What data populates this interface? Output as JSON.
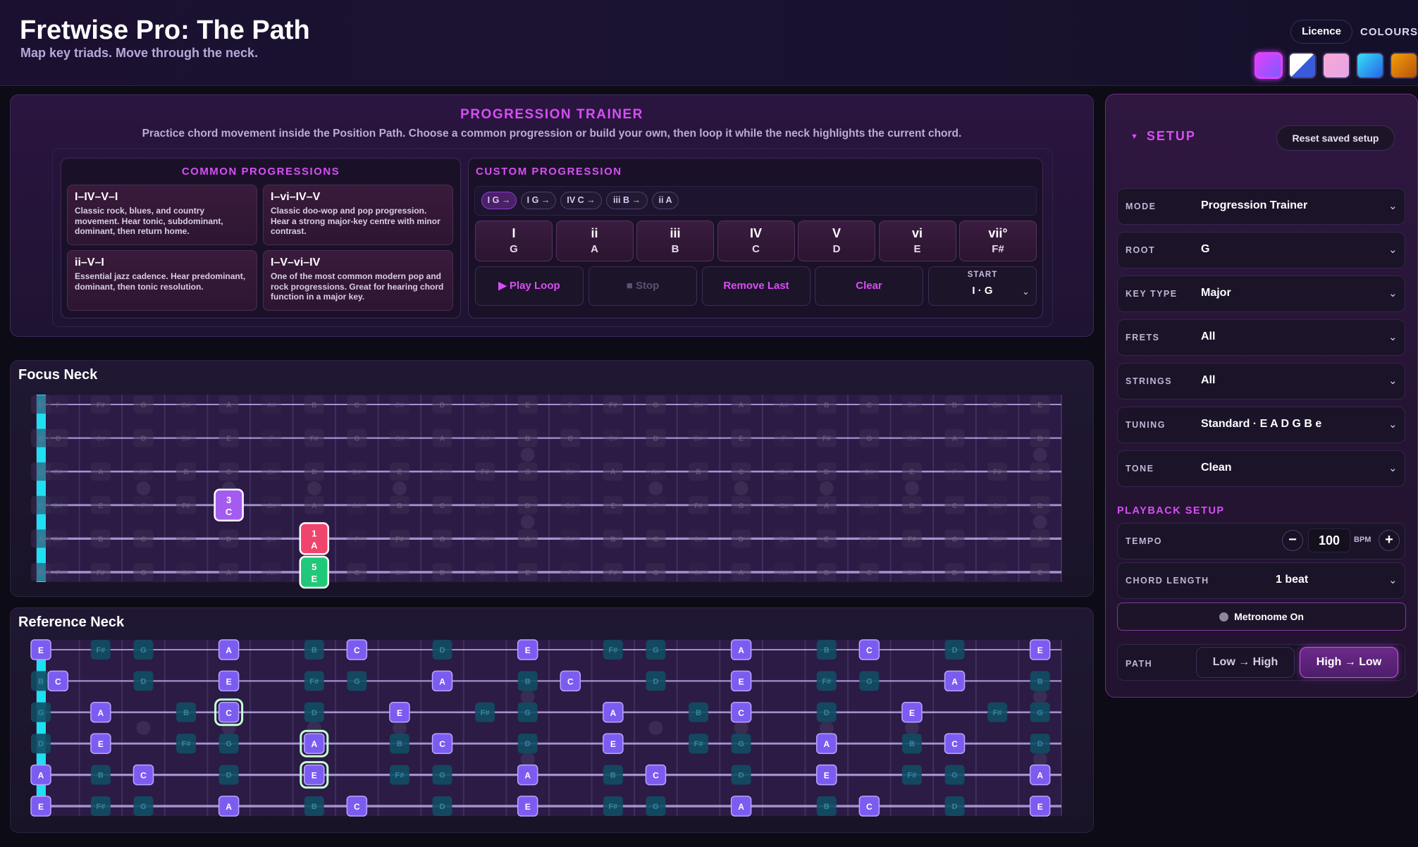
{
  "header": {
    "title": "Fretwise Pro: The Path",
    "subtitle": "Map key triads. Move through the neck.",
    "licence_label": "Licence",
    "colours_label": "COLOURS",
    "swatches": [
      {
        "name": "magenta-violet",
        "gradient": [
          "#e040fb",
          "#7b5cff"
        ],
        "active": true
      },
      {
        "name": "blue-white-split",
        "gradient": [
          "#ffffff",
          "#3a5bd9"
        ],
        "active": false
      },
      {
        "name": "pink-blush",
        "gradient": [
          "#f9a8d4",
          "#e3a5e8"
        ],
        "active": false
      },
      {
        "name": "cyan-blue",
        "gradient": [
          "#38e0f5",
          "#2563eb"
        ],
        "active": false
      },
      {
        "name": "amber-orange",
        "gradient": [
          "#f59e0b",
          "#b45309"
        ],
        "active": false
      }
    ]
  },
  "trainer": {
    "title": "PROGRESSION TRAINER",
    "description": "Practice chord movement inside the Position Path. Choose a common progression or build your own, then loop it while the neck highlights the current chord.",
    "common": {
      "title": "COMMON PROGRESSIONS",
      "items": [
        {
          "name": "I–IV–V–I",
          "desc": "Classic rock, blues, and country movement. Hear tonic, subdominant, dominant, then return home."
        },
        {
          "name": "I–vi–IV–V",
          "desc": "Classic doo-wop and pop progression. Hear a strong major-key centre with minor contrast."
        },
        {
          "name": "ii–V–I",
          "desc": "Essential jazz cadence. Hear predominant, dominant, then tonic resolution."
        },
        {
          "name": "I–V–vi–IV",
          "desc": "One of the most common modern pop and rock progressions. Great for hearing chord function in a major key."
        }
      ]
    },
    "custom": {
      "title": "CUSTOM PROGRESSION",
      "chips": [
        "I G →",
        "I G →",
        "IV C →",
        "iii B →",
        "ii A"
      ],
      "degrees": [
        {
          "roman": "I",
          "note": "G"
        },
        {
          "roman": "ii",
          "note": "A"
        },
        {
          "roman": "iii",
          "note": "B"
        },
        {
          "roman": "IV",
          "note": "C"
        },
        {
          "roman": "V",
          "note": "D"
        },
        {
          "roman": "vi",
          "note": "E"
        },
        {
          "roman": "vii°",
          "note": "F#"
        }
      ],
      "play_label": "▶ Play Loop",
      "stop_label": "■ Stop",
      "remove_label": "Remove Last",
      "clear_label": "Clear",
      "start_label": "START",
      "start_value": "I · G"
    }
  },
  "focus": {
    "title": "Focus Neck",
    "highlights": [
      {
        "string": 3,
        "fret": 5,
        "degree": "3",
        "note": "C",
        "color": "#a45cf0"
      },
      {
        "string": 4,
        "fret": 7,
        "degree": "1",
        "note": "A",
        "color": "#f0446c"
      },
      {
        "string": 5,
        "fret": 7,
        "degree": "5",
        "note": "E",
        "color": "#22c87a"
      }
    ]
  },
  "reference": {
    "title": "Reference Neck"
  },
  "setup": {
    "title": "SETUP",
    "reset_label": "Reset saved setup",
    "fields": [
      {
        "label": "MODE",
        "value": "Progression Trainer"
      },
      {
        "label": "ROOT",
        "value": "G"
      },
      {
        "label": "KEY TYPE",
        "value": "Major"
      },
      {
        "label": "FRETS",
        "value": "All"
      },
      {
        "label": "STRINGS",
        "value": "All"
      },
      {
        "label": "TUNING",
        "value": "Standard · E A D G B e"
      },
      {
        "label": "TONE",
        "value": "Clean"
      }
    ],
    "playback_title": "PLAYBACK SETUP",
    "tempo_label": "TEMPO",
    "tempo_value": "100",
    "tempo_unit": "BPM",
    "chord_length_label": "CHORD LENGTH",
    "chord_length_value": "1 beat",
    "metronome_label": "Metronome On",
    "path_label": "PATH",
    "path_low_high": "Low → High",
    "path_high_low": "High → Low"
  },
  "colors": {
    "accent": "#d84ef5",
    "chord_tone": "#7c5cf0",
    "nut": "#1ee0f0"
  }
}
